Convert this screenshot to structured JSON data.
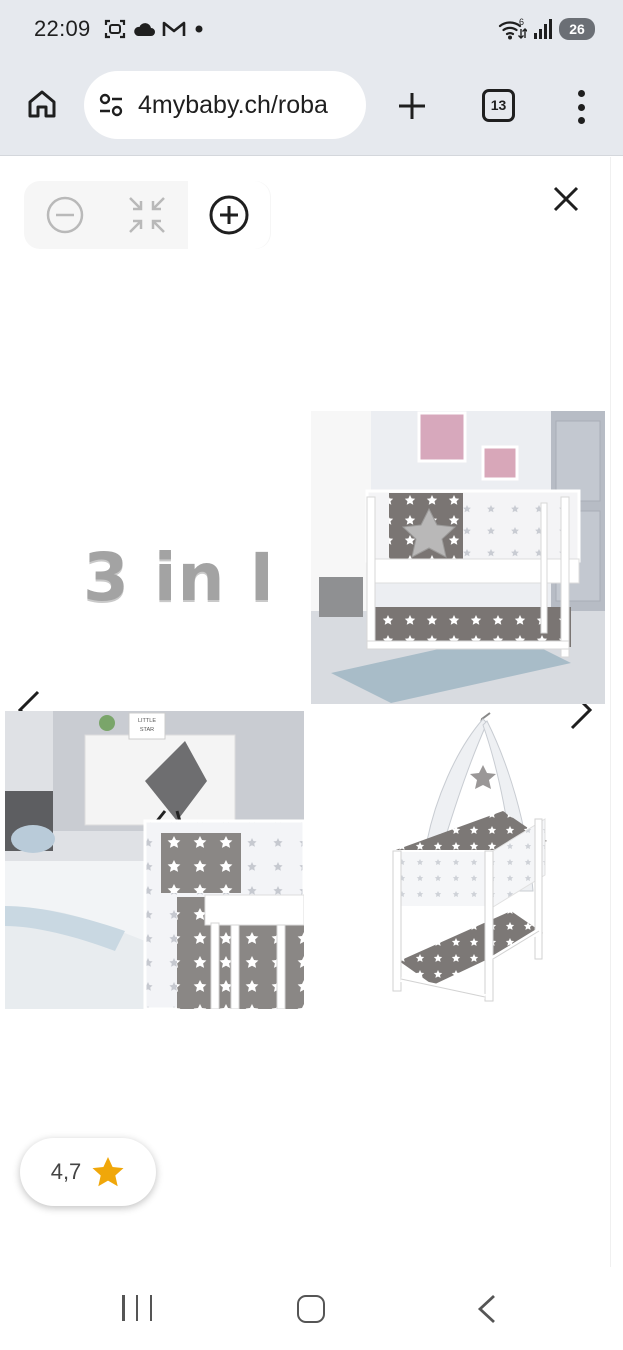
{
  "status_bar": {
    "time": "22:09",
    "icons_left": [
      "screenshot-icon",
      "cloud-icon",
      "gmail-icon",
      "dot-icon"
    ],
    "icons_right": [
      "wifi-icon",
      "signal-icon"
    ],
    "battery": "26"
  },
  "browser": {
    "url": "4mybaby.ch/roba",
    "tab_count": "13"
  },
  "viewer": {
    "collage_caption": "3 in I",
    "photo_labels": [
      "LITTLE",
      "STAR"
    ]
  },
  "rating": {
    "value": "4,7",
    "star_color": "#f0a70a"
  },
  "colors": {
    "chrome_bg": "#e6e9ee",
    "icon_dark": "#1f1f1f",
    "star_gray": "#7a7573"
  }
}
